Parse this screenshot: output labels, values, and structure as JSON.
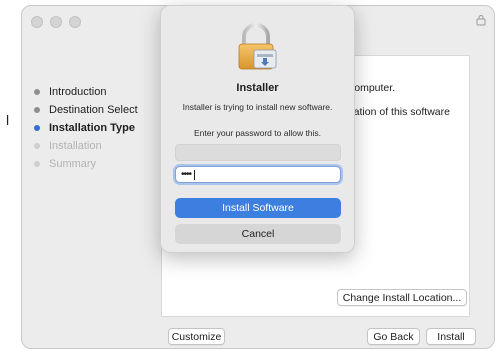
{
  "stray_character": "l",
  "window": {
    "traffic_lights": [
      "close-button",
      "minimize-button",
      "zoom-button"
    ],
    "lock_icon": "lock-icon"
  },
  "sidebar": {
    "steps": [
      {
        "label": "Introduction",
        "state": "done"
      },
      {
        "label": "Destination Select",
        "state": "done"
      },
      {
        "label": "Installation Type",
        "state": "active"
      },
      {
        "label": "Installation",
        "state": "disabled"
      },
      {
        "label": "Summary",
        "state": "disabled"
      }
    ]
  },
  "content": {
    "fragment_1": "computer.",
    "fragment_2": "llation of this software",
    "change_location_label": "Change Install Location..."
  },
  "footer": {
    "customize_label": "Customize",
    "go_back_label": "Go Back",
    "install_label": "Install"
  },
  "dialog": {
    "icon": "installer-package-lock-icon",
    "title": "Installer",
    "message": "Installer is trying to install new software.",
    "prompt": "Enter your password to allow this.",
    "username_value": "",
    "password_masked": "••••",
    "install_software_label": "Install Software",
    "cancel_label": "Cancel"
  },
  "colors": {
    "accent": "#3c7fe0",
    "active_step_dot": "#2f6fd6",
    "window_bg": "#ececec"
  }
}
